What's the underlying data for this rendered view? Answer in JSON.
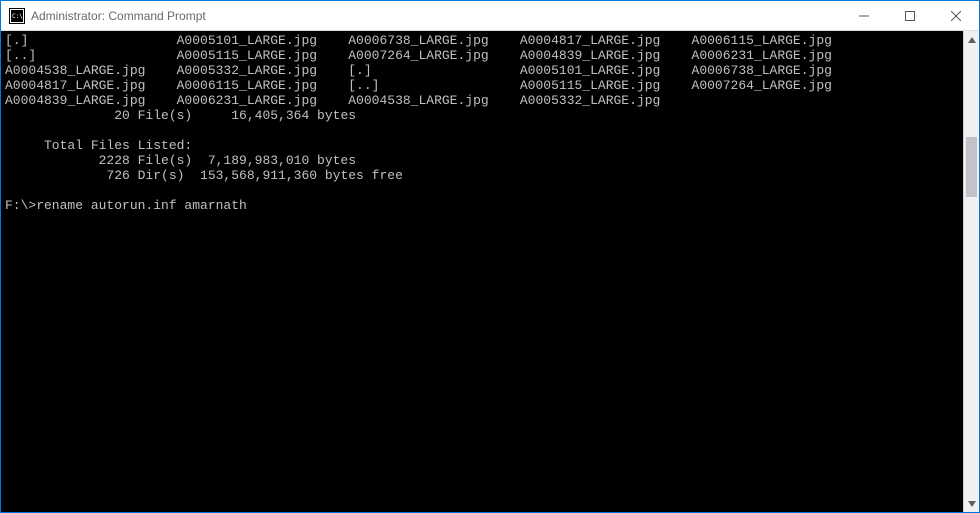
{
  "window": {
    "title": "Administrator: Command Prompt"
  },
  "terminal": {
    "lines": [
      "[.]                   A0005101_LARGE.jpg    A0006738_LARGE.jpg    A0004817_LARGE.jpg    A0006115_LARGE.jpg",
      "[..]                  A0005115_LARGE.jpg    A0007264_LARGE.jpg    A0004839_LARGE.jpg    A0006231_LARGE.jpg",
      "A0004538_LARGE.jpg    A0005332_LARGE.jpg    [.]                   A0005101_LARGE.jpg    A0006738_LARGE.jpg",
      "A0004817_LARGE.jpg    A0006115_LARGE.jpg    [..]                  A0005115_LARGE.jpg    A0007264_LARGE.jpg",
      "A0004839_LARGE.jpg    A0006231_LARGE.jpg    A0004538_LARGE.jpg    A0005332_LARGE.jpg",
      "              20 File(s)     16,405,364 bytes",
      "",
      "     Total Files Listed:",
      "            2228 File(s)  7,189,983,010 bytes",
      "             726 Dir(s)  153,568,911,360 bytes free",
      "",
      "F:\\>rename autorun.inf amarnath"
    ]
  }
}
